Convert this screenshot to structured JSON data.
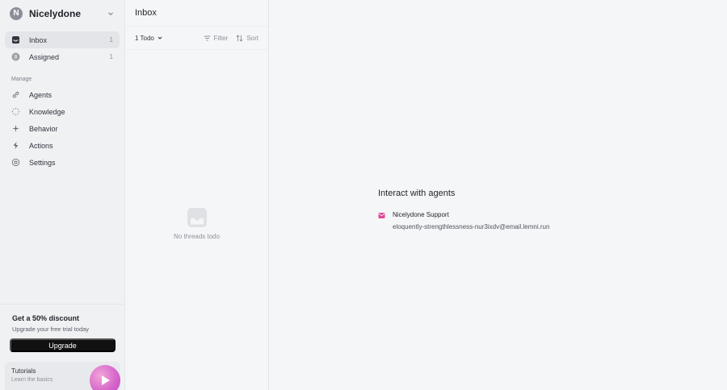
{
  "workspace": {
    "initial": "N",
    "name": "Nicelydone"
  },
  "nav": [
    {
      "label": "Inbox",
      "count": "1"
    },
    {
      "label": "Assigned",
      "count": "1"
    }
  ],
  "manage": {
    "label": "Manage",
    "items": [
      {
        "label": "Agents"
      },
      {
        "label": "Knowledge"
      },
      {
        "label": "Behavior"
      },
      {
        "label": "Actions"
      },
      {
        "label": "Settings"
      }
    ]
  },
  "promo": {
    "title": "Get a 50% discount",
    "subtitle": "Upgrade your free trial today",
    "button": "Upgrade"
  },
  "tutorial": {
    "title": "Tutorials",
    "subtitle": "Learn the basics"
  },
  "threads": {
    "title": "Inbox",
    "filter_value": "1 Todo",
    "filter_label": "Filter",
    "sort_label": "Sort",
    "empty_text": "No threads todo"
  },
  "main": {
    "title": "Interact with agents",
    "agent": {
      "name": "Nicelydone Support",
      "email": "eloquently-strengthlessness-nur3ixdv@email.lemni.run"
    }
  },
  "colors": {
    "accent_pink": "#e0489b",
    "upgrade_bg": "#111111"
  }
}
